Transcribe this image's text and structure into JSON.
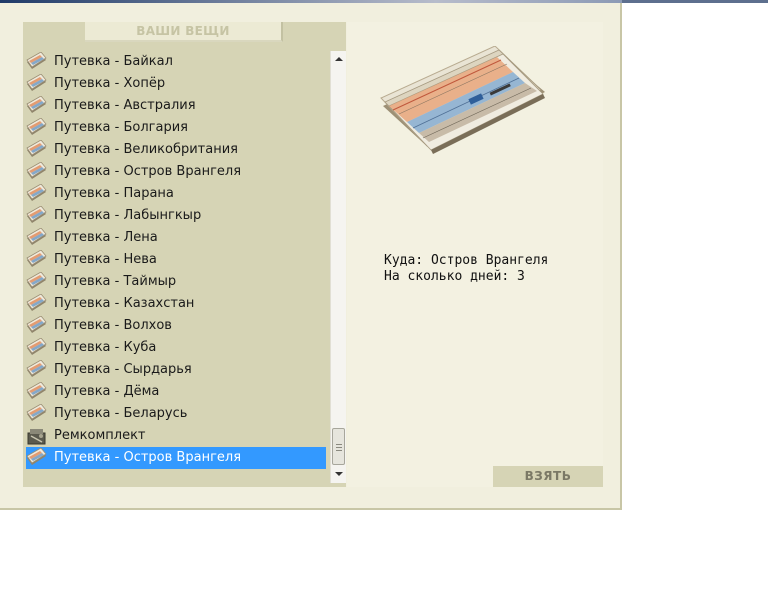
{
  "panel": {
    "title": "ВАШИ ВЕЩИ"
  },
  "items": [
    {
      "label": "Путевка - Байкал",
      "icon": "ticket-icon"
    },
    {
      "label": "Путевка - Хопёр",
      "icon": "ticket-icon"
    },
    {
      "label": "Путевка - Австралия",
      "icon": "ticket-icon"
    },
    {
      "label": "Путевка - Болгария",
      "icon": "ticket-icon"
    },
    {
      "label": "Путевка - Великобритания",
      "icon": "ticket-icon"
    },
    {
      "label": "Путевка - Остров Врангеля",
      "icon": "ticket-icon"
    },
    {
      "label": "Путевка - Парана",
      "icon": "ticket-icon"
    },
    {
      "label": "Путевка - Лабынгкыр",
      "icon": "ticket-icon"
    },
    {
      "label": "Путевка - Лена",
      "icon": "ticket-icon"
    },
    {
      "label": "Путевка - Нева",
      "icon": "ticket-icon"
    },
    {
      "label": "Путевка - Таймыр",
      "icon": "ticket-icon"
    },
    {
      "label": "Путевка - Казахстан",
      "icon": "ticket-icon"
    },
    {
      "label": "Путевка - Волхов",
      "icon": "ticket-icon"
    },
    {
      "label": "Путевка - Куба",
      "icon": "ticket-icon"
    },
    {
      "label": "Путевка - Сырдарья",
      "icon": "ticket-icon"
    },
    {
      "label": "Путевка - Дёма",
      "icon": "ticket-icon"
    },
    {
      "label": "Путевка - Беларусь",
      "icon": "ticket-icon"
    },
    {
      "label": "Ремкомплект",
      "icon": "repair-kit-icon"
    },
    {
      "label": "Путевка - Остров Врангеля",
      "icon": "ticket-icon",
      "selected": true
    }
  ],
  "details": {
    "destination": "Куда: Остров Врангеля",
    "days": "На сколько дней: 3"
  },
  "actions": {
    "take_label": "ВЗЯТЬ"
  },
  "colors": {
    "panel_bg": "#d6d4b5",
    "window_bg": "#f1efde",
    "selection": "#3399ff"
  }
}
